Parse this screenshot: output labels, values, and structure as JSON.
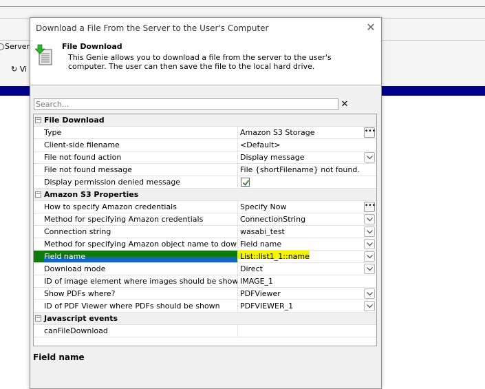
{
  "background": {
    "server_label": "Server-",
    "vi_label": "↻ Vi",
    "bar_color": "#00008a"
  },
  "dialog": {
    "title": "Download a File From the Server to the User's Computer",
    "close_icon": "close-icon",
    "header": {
      "icon": "file-download-icon",
      "title": "File Download",
      "description": "This Genie allows you to download a file from the server to the user's computer. The user can then save the file to the local hard drive."
    },
    "search": {
      "placeholder": "Search...",
      "clear_label": "✕"
    },
    "categories": [
      {
        "title": "File Download",
        "rows": [
          {
            "name": "Type",
            "value": "Amazon S3 Storage",
            "control": "ellipsis"
          },
          {
            "name": "Client-side filename",
            "value": "<Default>",
            "control": "none"
          },
          {
            "name": "File not found action",
            "value": "Display message",
            "control": "dropdown"
          },
          {
            "name": "File not found message",
            "value": "File {shortFilename} not found.",
            "control": "none"
          },
          {
            "name": "Display permission denied message",
            "value": "",
            "control": "checkbox",
            "checked": true
          }
        ]
      },
      {
        "title": "Amazon S3 Properties",
        "rows": [
          {
            "name": "How to specify Amazon credentials",
            "value": "Specify Now",
            "control": "ellipsis"
          },
          {
            "name": "Method for specifying Amazon credentials",
            "value": "ConnectionString",
            "control": "dropdown"
          },
          {
            "name": "Connection string",
            "value": "wasabi_test",
            "control": "dropdown"
          },
          {
            "name": "Method for specifying Amazon object name to download",
            "value": "Field name",
            "control": "dropdown"
          },
          {
            "name": "Field name",
            "value": "List::list1_1::name",
            "control": "dropdown",
            "selected": true
          },
          {
            "name": "Download mode",
            "value": "Direct",
            "control": "dropdown"
          },
          {
            "name": "ID of image element where images should be shown",
            "value": "IMAGE_1",
            "control": "none"
          },
          {
            "name": "Show PDFs where?",
            "value": "PDFViewer",
            "control": "dropdown"
          },
          {
            "name": "ID of PDF Viewer where PDFs should be shown",
            "value": "PDFVIEWER_1",
            "control": "dropdown"
          }
        ]
      },
      {
        "title": "Javascript events",
        "rows": [
          {
            "name": "canFileDownload",
            "value": "",
            "control": "none"
          }
        ]
      }
    ],
    "description_title": "Field name",
    "colors": {
      "selection_green": "#0e7a0e",
      "selection_blue": "#1565c0",
      "highlight_yellow": "#f5f500"
    }
  }
}
